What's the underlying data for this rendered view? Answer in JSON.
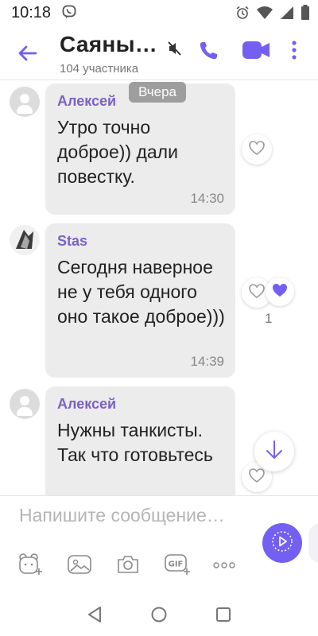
{
  "status_bar": {
    "time": "10:18"
  },
  "header": {
    "title": "Саяны…",
    "subtitle": "104 участника"
  },
  "date_separator": "Вчера",
  "messages": [
    {
      "sender": "Алексей",
      "text": "Утро точно доброе)) дали повестку.",
      "time": "14:30"
    },
    {
      "sender": "Stas",
      "text": "Сегодня наверное не у тебя одного оно такое доброе)))",
      "time": "14:39",
      "likes": "1"
    },
    {
      "sender": "Алексей",
      "text": "Нужны танкисты. Так что готовьтесь"
    }
  ],
  "composer": {
    "placeholder": "Напишите сообщение…"
  },
  "colors": {
    "accent": "#7360f2",
    "bubble": "#ececec",
    "sender": "#7b61c4"
  }
}
